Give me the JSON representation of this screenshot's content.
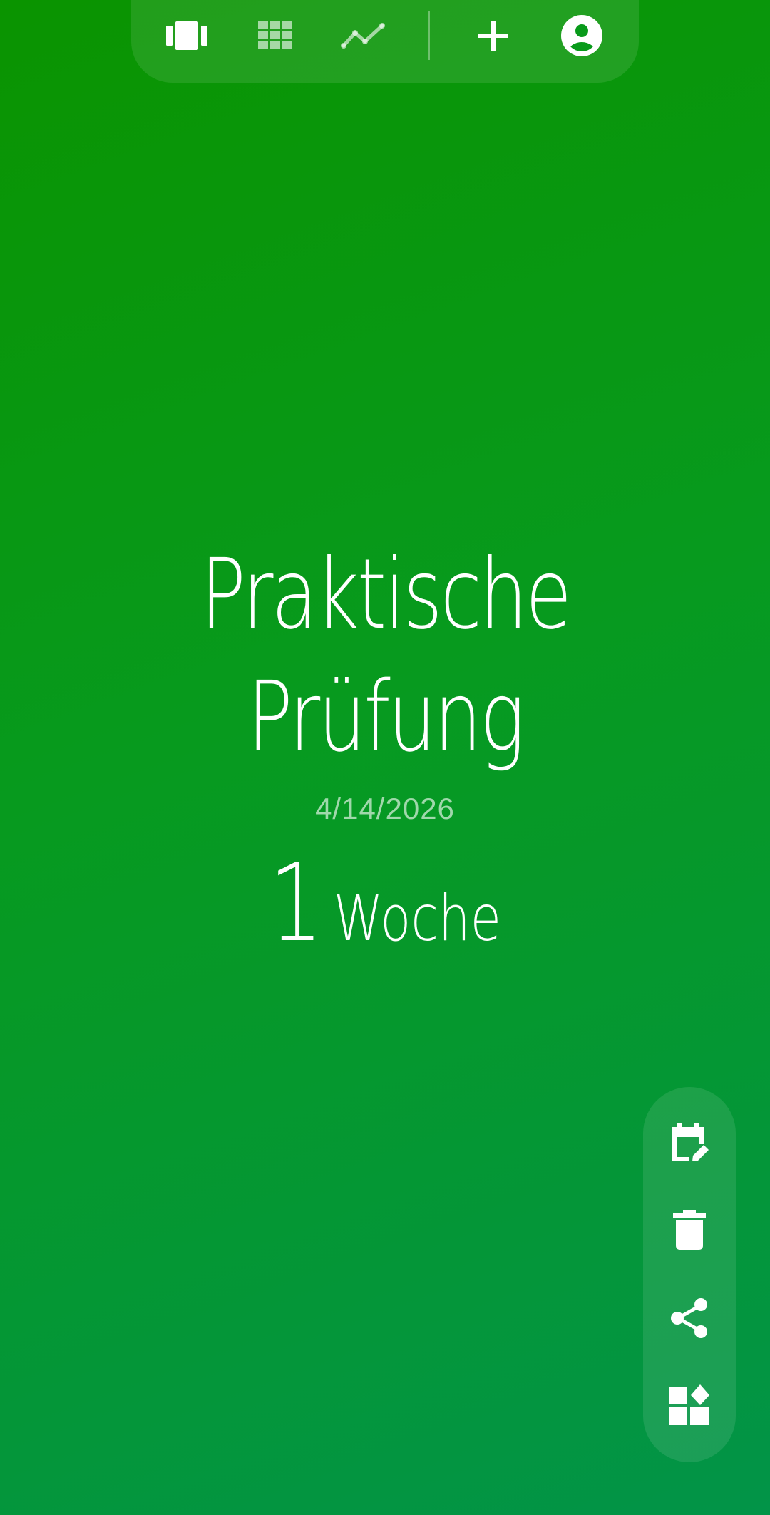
{
  "topbar": {
    "icons": [
      "carousel-icon",
      "grid-icon",
      "chart-icon",
      "add-icon",
      "account-icon"
    ]
  },
  "event": {
    "title_line1": "Praktische",
    "title_line2": "Prüfung",
    "date": "4/14/2026",
    "count_number": "1",
    "count_unit": "Woche"
  },
  "sidebar": {
    "icons": [
      "edit-calendar-icon",
      "delete-icon",
      "share-icon",
      "widgets-icon"
    ]
  },
  "colors": {
    "background_start": "#0a9400",
    "background_end": "#029448",
    "foreground": "#ffffff"
  }
}
